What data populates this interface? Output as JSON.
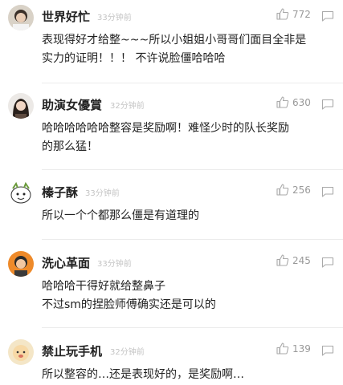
{
  "comments": [
    {
      "username": "世界好忙",
      "time": "33分钟前",
      "likes": "772",
      "lines": [
        "表现得好才给整~~~所以小姐姐小哥哥们面目全非是",
        "实力的证明！！！ 不许说脸僵哈哈哈"
      ]
    },
    {
      "username": "助演女優賞",
      "time": "32分钟前",
      "likes": "630",
      "lines": [
        "哈哈哈哈哈哈整容是奖励啊！难怪少时的队长奖励",
        "的那么猛！"
      ]
    },
    {
      "username": "榛子酥",
      "time": "33分钟前",
      "likes": "256",
      "lines": [
        "所以一个个都那么僵是有道理的"
      ]
    },
    {
      "username": "洗心革面",
      "time": "33分钟前",
      "likes": "245",
      "lines": [
        "哈哈哈干得好就给整鼻子",
        "不过sm的捏脸师傅确实还是可以的"
      ]
    },
    {
      "username": "禁止玩手机",
      "time": "32分钟前",
      "likes": "139",
      "lines": [
        "所以整容的…还是表现好的，是奖励啊…"
      ]
    }
  ]
}
